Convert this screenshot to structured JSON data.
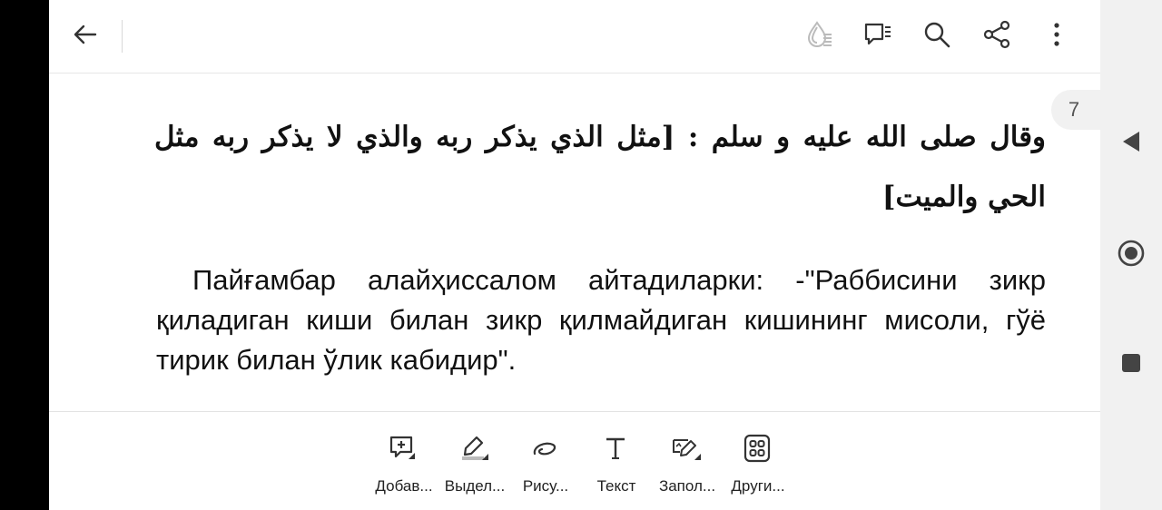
{
  "toolbar": {
    "back_icon": "arrow-left-icon",
    "actions": [
      {
        "name": "reading-mode-icon"
      },
      {
        "name": "comments-icon"
      },
      {
        "name": "search-icon"
      },
      {
        "name": "share-icon"
      },
      {
        "name": "more-vertical-icon"
      }
    ]
  },
  "page": {
    "number": "7"
  },
  "document": {
    "arabic_text": "وقال صلى الله عليه و سلم : [مثل الذي يذكر ربه والذي لا يذكر ربه مثل الحي والميت]",
    "uzbek_text": "Пайғамбар алайҳиссалом айтадиларки: -\"Раббисини зикр қиладиган киши билан зикр қилмайдиган кишининг мисоли, гўё тирик билан ўлик кабидир\"."
  },
  "bottom_tools": [
    {
      "label": "Добав...",
      "icon": "add-comment-icon"
    },
    {
      "label": "Выдел...",
      "icon": "highlight-icon"
    },
    {
      "label": "Рису...",
      "icon": "draw-icon"
    },
    {
      "label": "Текст",
      "icon": "text-icon"
    },
    {
      "label": "Запол...",
      "icon": "fill-sign-icon"
    },
    {
      "label": "Други...",
      "icon": "more-tools-icon"
    }
  ],
  "system_nav": [
    {
      "name": "nav-back-icon"
    },
    {
      "name": "nav-home-icon"
    },
    {
      "name": "nav-recents-icon"
    }
  ],
  "colors": {
    "background": "#ffffff",
    "text": "#111111",
    "icon": "#333333",
    "faded_icon": "#bbbbbb",
    "nav_bar": "#f1f1f1"
  }
}
